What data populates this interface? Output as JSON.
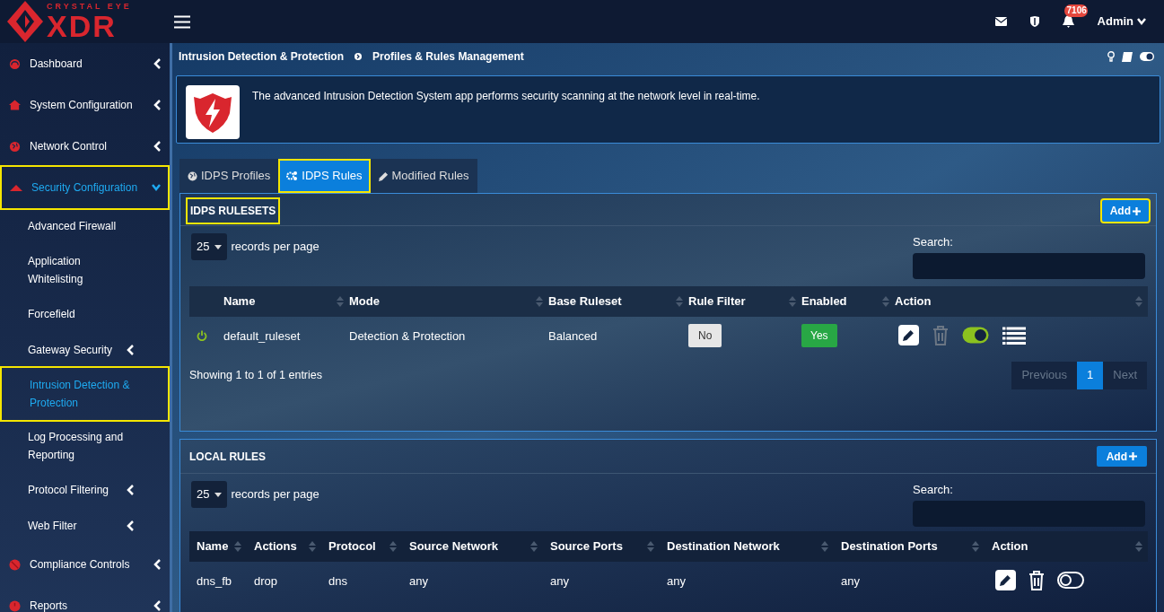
{
  "topbar": {
    "logo_small": "CRYSTAL EYE",
    "logo_big": "XDR",
    "notification_count": "7106",
    "user": "Admin"
  },
  "sidebar": {
    "items": [
      {
        "label": "Dashboard",
        "kind": "dashboard",
        "selected": false,
        "expanded": false,
        "highlighted": false
      },
      {
        "label": "System Configuration",
        "kind": "home",
        "selected": false,
        "expanded": false,
        "highlighted": false
      },
      {
        "label": "Network Control",
        "kind": "globe",
        "selected": false,
        "expanded": false,
        "highlighted": false
      },
      {
        "label": "Security Configuration",
        "kind": "cloud",
        "selected": true,
        "expanded": true,
        "highlighted": true,
        "children": [
          {
            "label": "Advanced Firewall",
            "selected": false,
            "expandable": false,
            "highlighted": false
          },
          {
            "label": "Application Whitelisting",
            "selected": false,
            "expandable": false,
            "highlighted": false
          },
          {
            "label": "Forcefield",
            "selected": false,
            "expandable": false,
            "highlighted": false
          },
          {
            "label": "Gateway Security",
            "selected": false,
            "expandable": true,
            "highlighted": false
          },
          {
            "label": "Intrusion Detection & Protection",
            "selected": true,
            "expandable": false,
            "highlighted": true
          },
          {
            "label": "Log Processing and Reporting",
            "selected": false,
            "expandable": false,
            "highlighted": false
          },
          {
            "label": "Protocol Filtering",
            "selected": false,
            "expandable": true,
            "highlighted": false
          },
          {
            "label": "Web Filter",
            "selected": false,
            "expandable": true,
            "highlighted": false
          }
        ]
      },
      {
        "label": "Compliance Controls",
        "kind": "ban",
        "selected": false,
        "expanded": false,
        "highlighted": false
      },
      {
        "label": "Reports",
        "kind": "clock",
        "selected": false,
        "expanded": false,
        "highlighted": false
      }
    ]
  },
  "breadcrumb": [
    "Intrusion Detection & Protection",
    "Profiles & Rules Management"
  ],
  "info": {
    "text": "The advanced Intrusion Detection System app performs security scanning at the network level in real-time."
  },
  "tabs": [
    {
      "label": "IDPS Profiles",
      "kind": "globe",
      "selected": false,
      "highlighted": false
    },
    {
      "label": "IDPS Rules",
      "kind": "cogs",
      "selected": true,
      "highlighted": true
    },
    {
      "label": "Modified Rules",
      "kind": "pencil",
      "selected": false,
      "highlighted": false
    }
  ],
  "rulesets": {
    "title": "IDPS RULESETS",
    "title_highlighted": true,
    "add_button": "Add",
    "add_highlighted": true,
    "page_size": "25",
    "page_size_label": "records per page",
    "search_label": "Search:",
    "columns": [
      "Name",
      "Mode",
      "Base Ruleset",
      "Rule Filter",
      "Enabled",
      "Action"
    ],
    "rows": [
      {
        "active": true,
        "name": "default_ruleset",
        "mode": "Detection & Protection",
        "base_ruleset": "Balanced",
        "rule_filter": "No",
        "enabled": "Yes",
        "on": true
      }
    ],
    "info": "Showing 1 to 1 of 1 entries",
    "pagination": [
      {
        "label": "Previous",
        "selected": false
      },
      {
        "label": "1",
        "selected": true
      },
      {
        "label": "Next",
        "selected": false
      }
    ]
  },
  "local_rules": {
    "title": "LOCAL RULES",
    "add_button": "Add",
    "page_size": "25",
    "page_size_label": "records per page",
    "search_label": "Search:",
    "columns": [
      "Name",
      "Actions",
      "Protocol",
      "Source Network",
      "Source Ports",
      "Destination Network",
      "Destination Ports",
      "Action"
    ],
    "rows": [
      {
        "cells": [
          "dns_fb",
          "drop",
          "dns",
          "any",
          "any",
          "any",
          "any"
        ],
        "on": false
      }
    ]
  }
}
